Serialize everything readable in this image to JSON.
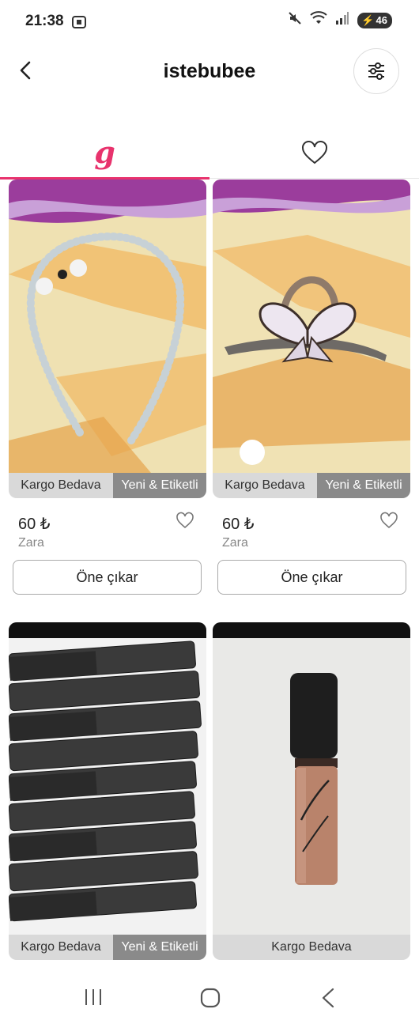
{
  "status": {
    "time": "21:38",
    "battery": "46"
  },
  "header": {
    "title": "istebubee"
  },
  "tabs": [
    {
      "name": "listings",
      "icon": "g-logo-icon",
      "active": true,
      "glyph": "g"
    },
    {
      "name": "favorites",
      "icon": "heart-icon",
      "active": false
    }
  ],
  "products": [
    {
      "cargo": "Kargo Bedava",
      "condition": "Yeni & Etiketli",
      "price": "60 ₺",
      "brand": "Zara",
      "boost": "Öne çıkar",
      "image": "pearl headband on yellow fabric"
    },
    {
      "cargo": "Kargo Bedava",
      "condition": "Yeni & Etiketli",
      "price": "60 ₺",
      "brand": "Zara",
      "boost": "Öne çıkar",
      "image": "butterfly hair claw clip on yellow fabric"
    },
    {
      "cargo": "Kargo Bedava",
      "condition": "Yeni & Etiketli",
      "image": "stack of black eyeshadow pencils"
    },
    {
      "cargo": "Kargo Bedava",
      "image": "liquid matte lipstick tube"
    }
  ],
  "colors": {
    "accent": "#e8336d",
    "badge_dark": "#8a8a8a",
    "badge_light": "#d9d9d9"
  }
}
